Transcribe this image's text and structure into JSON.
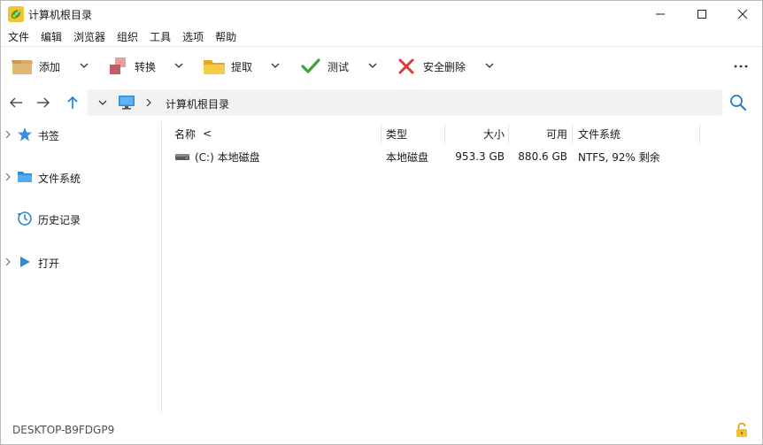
{
  "window": {
    "title": "计算机根目录"
  },
  "menu": {
    "items": [
      "文件",
      "编辑",
      "浏览器",
      "组织",
      "工具",
      "选项",
      "帮助"
    ]
  },
  "toolbar": {
    "add_label": "添加",
    "convert_label": "转换",
    "extract_label": "提取",
    "test_label": "测试",
    "secure_delete_label": "安全删除",
    "more_label": "···"
  },
  "address": {
    "path": "计算机根目录"
  },
  "sidebar": {
    "items": [
      {
        "label": "书签",
        "icon": "star-icon"
      },
      {
        "label": "文件系统",
        "icon": "folder-icon"
      },
      {
        "label": "历史记录",
        "icon": "history-icon"
      },
      {
        "label": "打开",
        "icon": "play-icon"
      }
    ]
  },
  "table": {
    "columns": {
      "name": "名称",
      "sort_indicator": "<",
      "type": "类型",
      "size": "大小",
      "free": "可用",
      "filesystem": "文件系统"
    },
    "rows": [
      {
        "name": "(C:) 本地磁盘",
        "type": "本地磁盘",
        "size": "953.3 GB",
        "free": "880.6 GB",
        "filesystem": "NTFS, 92% 剩余"
      }
    ]
  },
  "status": {
    "computer_name": "DESKTOP-B9FDGP9"
  },
  "colors": {
    "accent_blue": "#1a7fd4",
    "check_green": "#3aa63a",
    "delete_red": "#d93a3a",
    "folder_yellow": "#f2c230"
  }
}
